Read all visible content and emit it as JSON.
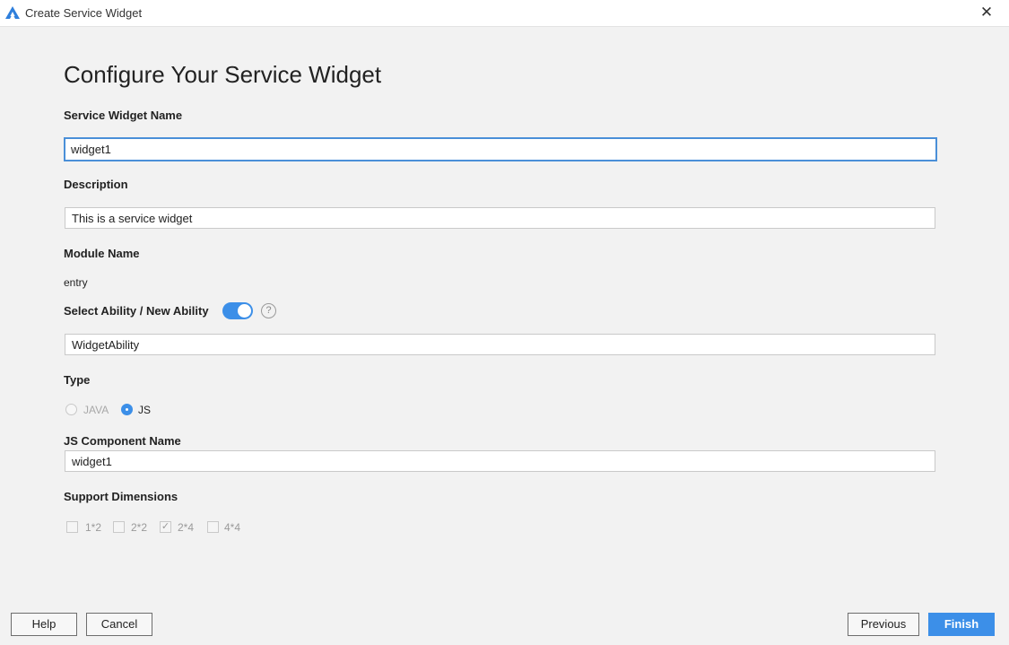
{
  "window": {
    "title": "Create Service Widget",
    "close_glyph": "✕",
    "icon": "deveco-logo-icon"
  },
  "heading": "Configure Your Service Widget",
  "widget_name": {
    "label": "Service Widget Name",
    "value": "widget1"
  },
  "description": {
    "label": "Description",
    "value": "This is a service widget"
  },
  "module": {
    "label": "Module Name",
    "value": "entry"
  },
  "ability": {
    "label": "Select Ability / New Ability",
    "toggle_on": true,
    "help_glyph": "?",
    "value": "WidgetAbility"
  },
  "type": {
    "label": "Type",
    "options": [
      "JAVA",
      "JS"
    ],
    "selected": "JS"
  },
  "js_component": {
    "label": "JS Component Name",
    "value": "widget1"
  },
  "dimensions": {
    "label": "Support Dimensions",
    "options": [
      {
        "label": "1*2",
        "checked": false
      },
      {
        "label": "2*2",
        "checked": false
      },
      {
        "label": "2*4",
        "checked": true
      },
      {
        "label": "4*4",
        "checked": false
      }
    ]
  },
  "buttons": {
    "help": "Help",
    "cancel": "Cancel",
    "previous": "Previous",
    "finish": "Finish"
  },
  "colors": {
    "accent": "#3c8fe8",
    "background": "#f2f2f2"
  }
}
